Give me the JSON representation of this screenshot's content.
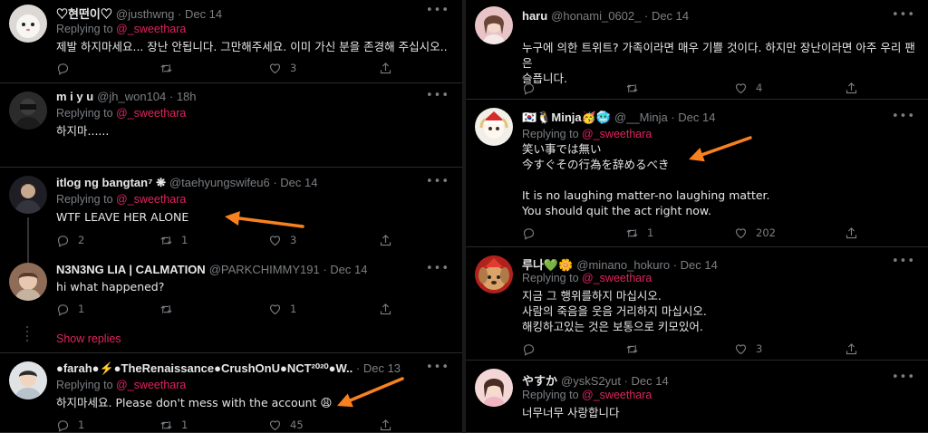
{
  "left": [
    {
      "name": "♡현떤이♡",
      "handle": "@justhwng",
      "date": "Dec 14",
      "replying_prefix": "Replying to",
      "replying_to": "@_sweethara",
      "text": "제발 하지마세요... 장난 안됩니다.  그만해주세요. 이미 가신 분을 존경해 주십시오..",
      "replies": "",
      "retweets": "",
      "likes": "3"
    },
    {
      "name": "m i y u",
      "handle": "@jh_won104",
      "date": "18h",
      "replying_prefix": "Replying to",
      "replying_to": "@_sweethara",
      "text": "하지마......",
      "replies": "",
      "retweets": "",
      "likes": ""
    },
    {
      "name": "itlog ng bangtan⁷ ❋",
      "handle": "@taehyungswifeu6",
      "date": "Dec 14",
      "replying_prefix": "Replying to",
      "replying_to": "@_sweethara",
      "text": "WTF LEAVE HER ALONE",
      "replies": "2",
      "retweets": "1",
      "likes": "3"
    },
    {
      "name": "N3N3NG LIA | CALMATION",
      "handle": "@PARKCHIMMY191",
      "date": "Dec 14",
      "replying_prefix": "",
      "replying_to": "",
      "text": "hi what happened?",
      "replies": "1",
      "retweets": "",
      "likes": "1"
    },
    {
      "name": "●farah●⚡●TheRenaissance●CrushOnU●NCT²⁰²⁰●W..",
      "handle": "",
      "date": "Dec 13",
      "replying_prefix": "Replying to",
      "replying_to": "@_sweethara",
      "text": "하지마세요. Please don't mess with the account 😩",
      "replies": "1",
      "retweets": "1",
      "likes": "45"
    }
  ],
  "show_replies": "Show replies",
  "right": [
    {
      "name": "haru",
      "handle": "@honami_0602_",
      "date": "Dec 14",
      "replying_prefix": "",
      "replying_to": "",
      "text": "누구에 의한 트위트? 가족이라면 매우 기쁠 것이다. 하지만 장난이라면 아주 우리 팬은\n슬픕니다.",
      "replies": "",
      "retweets": "",
      "likes": "4"
    },
    {
      "name": "🇰🇷🐧Minja🥳🥶",
      "handle": "@__Minja",
      "date": "Dec 14",
      "replying_prefix": "Replying to",
      "replying_to": "@_sweethara",
      "text": "笑い事では無い\n今すぐその行為を辞めるべき\n\nIt is no laughing matter-no laughing matter.\nYou should quit the act right now.",
      "replies": "",
      "retweets": "1",
      "likes": "202"
    },
    {
      "name": "루나💚🌼",
      "handle": "@minano_hokuro",
      "date": "Dec 14",
      "replying_prefix": "Replying to",
      "replying_to": "@_sweethara",
      "text": "지금 그 행위를하지 마십시오.\n사람의 죽음을 웃음 거리하지 마십시오.\n해킹하고있는 것은 보통으로 키모있어.",
      "replies": "",
      "retweets": "",
      "likes": "3"
    },
    {
      "name": "やすか",
      "handle": "@yskS2yut",
      "date": "Dec 14",
      "replying_prefix": "Replying to",
      "replying_to": "@_sweethara",
      "text": "너무너무 사랑합니다",
      "replies": "",
      "retweets": "",
      "likes": ""
    }
  ],
  "more_label": "•••",
  "colors": {
    "background": "#000000",
    "mention": "#e0245e",
    "muted": "#7b7f83",
    "arrow": "#f7811f"
  },
  "icons": [
    "reply-icon",
    "retweet-icon",
    "like-icon",
    "share-icon",
    "more-icon"
  ]
}
